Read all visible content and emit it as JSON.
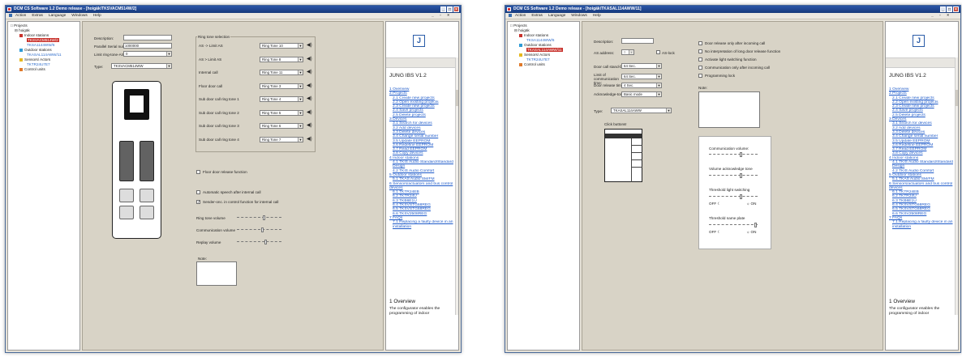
{
  "colors": {
    "titlebar": "#1f4a9a",
    "selection": "#c8322c",
    "link": "#2a6acb"
  },
  "window1": {
    "title": "DCM CS Software 1.2 Demo release - [hoigäk\\TKSVACM514W/2]",
    "menu": [
      "Action",
      "Extras",
      "Language",
      "Windows",
      "Help"
    ],
    "tree": {
      "root": "Projects",
      "project": "hoigäk",
      "indoor": "Indoor stations",
      "indoor_1": "TKSVACM514W/2",
      "indoor_2": "TKSA1144WW/6",
      "outdoor": "Outdoor stations",
      "outdoor_1": "TKASAL114AWW/11",
      "sensors": "Sensors/ Actors",
      "sensors_1": "TKTR24U7E7",
      "control": "Control units"
    },
    "form": {
      "desc_label": "Description:",
      "desc_value": "",
      "serial_label": "Parallel Serial number 1:",
      "serial_value": "1000000",
      "limit_label": "Limit ring-tone-AS:",
      "limit_value": "0",
      "type_label": "Type:",
      "type_value": "TKSVACM514WW"
    },
    "ringtone": {
      "title": "Ring tone selection",
      "rows": [
        {
          "label": "AS -> Limit AS",
          "value": "Ring Tone 10"
        },
        {
          "label": "AS > Limit AS",
          "value": "Ring Tone 8"
        },
        {
          "label": "Internal call",
          "value": "Ring Tone 11"
        },
        {
          "label": "Floor door call",
          "value": "Ring Tone 3"
        },
        {
          "label": "Sub door call ring tone 1",
          "value": "Ring Tone 4"
        },
        {
          "label": "Sub door call ring tone 2",
          "value": "Ring Tone 5"
        },
        {
          "label": "Sub door call ring tone 3",
          "value": "Ring Tone 6"
        },
        {
          "label": "Sub door call ring tone 4",
          "value": "Ring Tone 7"
        }
      ]
    },
    "checks": {
      "floor_release": "Floor door release function",
      "auto_speech": "Automatic speech after internal call",
      "sender_onc": "Sender-onc. in control function for internal call"
    },
    "sliders": {
      "ring": "Ring tone volume",
      "comm": "Communication volume",
      "replay": "Replay volume"
    },
    "note_label": "Note:"
  },
  "window2": {
    "title": "DCM CS Software 1.2 Demo release - [hoigäk\\TKASAL114AWW/11]",
    "menu": [
      "Action",
      "Extras",
      "Language",
      "Windows",
      "Help"
    ],
    "tree": {
      "root": "Projects",
      "project": "hoigäk",
      "indoor": "Indoor stations",
      "indoor_1": "TKSA1144WW/6",
      "outdoor": "Outdoor stations",
      "outdoor_1": "TKASAL114AWW/11",
      "sensors": "Sensors/ Actors",
      "sensors_1": "TKTR24U7E7",
      "control": "Control units"
    },
    "form": {
      "desc_label": "Description:",
      "as_label": "AS address:",
      "as_value": "0",
      "aslock_label": "AS-lock",
      "standby_label": "Door call stand-by:",
      "standby_value": "64 Sec.",
      "limit_label": "Limit of communication time:",
      "limit_value": "64 Sec.",
      "release_label": "Door release time:",
      "release_value": "4 Sec.",
      "ack_label": "Acknowledge-tones:",
      "ack_value": "Basic mode",
      "type_label": "Type:",
      "type_value": "TKASAL114AWW",
      "click_label": "Click buttons!"
    },
    "checks": [
      "Door release only after incoming call",
      "No interpretation of long door release function",
      "Activate light switching function",
      "Communication only after incoming call",
      "Programming lock"
    ],
    "note_label": "Note:",
    "sliders": {
      "comm": "Communication volume:",
      "ack": "Volume acknowledge tone",
      "threshold_light": "Threshold light switching",
      "threshold_plate": "Threshold name plate",
      "off": "OFF",
      "on": "ON"
    }
  },
  "help": {
    "title": "JUNG IBS V1.2",
    "toc": [
      "1 Overview",
      "2 Projects",
      "2.1 Create new projects",
      "2.2 Open existing projects",
      "2.3 Create new projects",
      "2.4 Save projects",
      "2.5 Delete projects",
      "3 Devices",
      "3.1 Search for devices",
      "3.2 Add devices",
      "3.3 Delete devices",
      "3.4 Change serial number",
      "3.5 Update EEPROM",
      "3.6 Redefine EEPROM",
      "3.7 Read EEPROM",
      "3.8 Copy devices",
      "4 Indoor stations",
      "4.1 TKIS Audio Standard/Standard Design",
      "4.2 TKIS Audio Comfort",
      "5 Outdoor stations",
      "5.1 TKAS Audio SM/FM",
      "6 Sensors/actuators and bus control devices",
      "6.1 TKTR24EB",
      "6.2 TKTR24U",
      "6.3 TKB6E1U",
      "6.4 TKSVSTG68REG",
      "6.5 TKSVSTG68REG",
      "6.6 TKSV2508REG",
      "7 FAQs",
      "7.1 Replacing a faulty device in an installation"
    ],
    "overview_title": "1 Overview",
    "overview_text": "The configurator enables the programming of indoor"
  }
}
